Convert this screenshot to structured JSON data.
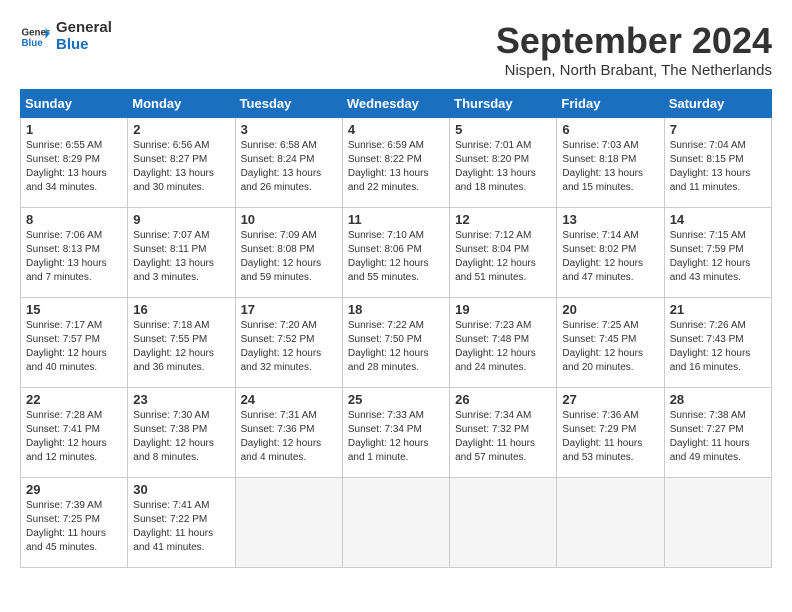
{
  "logo": {
    "line1": "General",
    "line2": "Blue"
  },
  "title": "September 2024",
  "subtitle": "Nispen, North Brabant, The Netherlands",
  "days_of_week": [
    "Sunday",
    "Monday",
    "Tuesday",
    "Wednesday",
    "Thursday",
    "Friday",
    "Saturday"
  ],
  "weeks": [
    [
      {
        "day": 1,
        "info": "Sunrise: 6:55 AM\nSunset: 8:29 PM\nDaylight: 13 hours\nand 34 minutes."
      },
      {
        "day": 2,
        "info": "Sunrise: 6:56 AM\nSunset: 8:27 PM\nDaylight: 13 hours\nand 30 minutes."
      },
      {
        "day": 3,
        "info": "Sunrise: 6:58 AM\nSunset: 8:24 PM\nDaylight: 13 hours\nand 26 minutes."
      },
      {
        "day": 4,
        "info": "Sunrise: 6:59 AM\nSunset: 8:22 PM\nDaylight: 13 hours\nand 22 minutes."
      },
      {
        "day": 5,
        "info": "Sunrise: 7:01 AM\nSunset: 8:20 PM\nDaylight: 13 hours\nand 18 minutes."
      },
      {
        "day": 6,
        "info": "Sunrise: 7:03 AM\nSunset: 8:18 PM\nDaylight: 13 hours\nand 15 minutes."
      },
      {
        "day": 7,
        "info": "Sunrise: 7:04 AM\nSunset: 8:15 PM\nDaylight: 13 hours\nand 11 minutes."
      }
    ],
    [
      {
        "day": 8,
        "info": "Sunrise: 7:06 AM\nSunset: 8:13 PM\nDaylight: 13 hours\nand 7 minutes."
      },
      {
        "day": 9,
        "info": "Sunrise: 7:07 AM\nSunset: 8:11 PM\nDaylight: 13 hours\nand 3 minutes."
      },
      {
        "day": 10,
        "info": "Sunrise: 7:09 AM\nSunset: 8:08 PM\nDaylight: 12 hours\nand 59 minutes."
      },
      {
        "day": 11,
        "info": "Sunrise: 7:10 AM\nSunset: 8:06 PM\nDaylight: 12 hours\nand 55 minutes."
      },
      {
        "day": 12,
        "info": "Sunrise: 7:12 AM\nSunset: 8:04 PM\nDaylight: 12 hours\nand 51 minutes."
      },
      {
        "day": 13,
        "info": "Sunrise: 7:14 AM\nSunset: 8:02 PM\nDaylight: 12 hours\nand 47 minutes."
      },
      {
        "day": 14,
        "info": "Sunrise: 7:15 AM\nSunset: 7:59 PM\nDaylight: 12 hours\nand 43 minutes."
      }
    ],
    [
      {
        "day": 15,
        "info": "Sunrise: 7:17 AM\nSunset: 7:57 PM\nDaylight: 12 hours\nand 40 minutes."
      },
      {
        "day": 16,
        "info": "Sunrise: 7:18 AM\nSunset: 7:55 PM\nDaylight: 12 hours\nand 36 minutes."
      },
      {
        "day": 17,
        "info": "Sunrise: 7:20 AM\nSunset: 7:52 PM\nDaylight: 12 hours\nand 32 minutes."
      },
      {
        "day": 18,
        "info": "Sunrise: 7:22 AM\nSunset: 7:50 PM\nDaylight: 12 hours\nand 28 minutes."
      },
      {
        "day": 19,
        "info": "Sunrise: 7:23 AM\nSunset: 7:48 PM\nDaylight: 12 hours\nand 24 minutes."
      },
      {
        "day": 20,
        "info": "Sunrise: 7:25 AM\nSunset: 7:45 PM\nDaylight: 12 hours\nand 20 minutes."
      },
      {
        "day": 21,
        "info": "Sunrise: 7:26 AM\nSunset: 7:43 PM\nDaylight: 12 hours\nand 16 minutes."
      }
    ],
    [
      {
        "day": 22,
        "info": "Sunrise: 7:28 AM\nSunset: 7:41 PM\nDaylight: 12 hours\nand 12 minutes."
      },
      {
        "day": 23,
        "info": "Sunrise: 7:30 AM\nSunset: 7:38 PM\nDaylight: 12 hours\nand 8 minutes."
      },
      {
        "day": 24,
        "info": "Sunrise: 7:31 AM\nSunset: 7:36 PM\nDaylight: 12 hours\nand 4 minutes."
      },
      {
        "day": 25,
        "info": "Sunrise: 7:33 AM\nSunset: 7:34 PM\nDaylight: 12 hours\nand 1 minute."
      },
      {
        "day": 26,
        "info": "Sunrise: 7:34 AM\nSunset: 7:32 PM\nDaylight: 11 hours\nand 57 minutes."
      },
      {
        "day": 27,
        "info": "Sunrise: 7:36 AM\nSunset: 7:29 PM\nDaylight: 11 hours\nand 53 minutes."
      },
      {
        "day": 28,
        "info": "Sunrise: 7:38 AM\nSunset: 7:27 PM\nDaylight: 11 hours\nand 49 minutes."
      }
    ],
    [
      {
        "day": 29,
        "info": "Sunrise: 7:39 AM\nSunset: 7:25 PM\nDaylight: 11 hours\nand 45 minutes."
      },
      {
        "day": 30,
        "info": "Sunrise: 7:41 AM\nSunset: 7:22 PM\nDaylight: 11 hours\nand 41 minutes."
      },
      null,
      null,
      null,
      null,
      null
    ]
  ]
}
